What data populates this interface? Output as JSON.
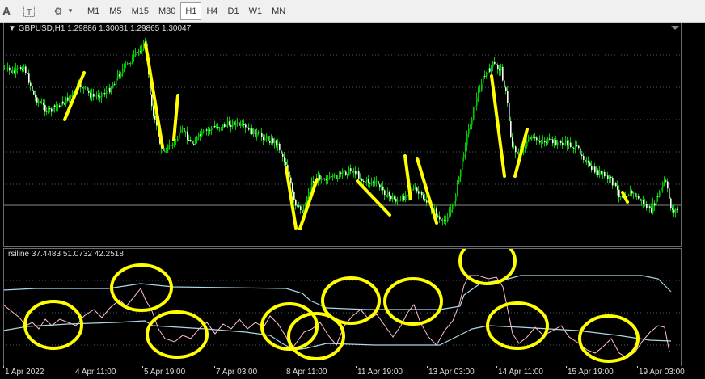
{
  "toolbar": {
    "text_tool": "A",
    "label_tool": "T",
    "shapes_tool": "⚙",
    "shapes_arrow": "▾",
    "timeframes": [
      {
        "label": "M1",
        "active": false
      },
      {
        "label": "M5",
        "active": false
      },
      {
        "label": "M15",
        "active": false
      },
      {
        "label": "M30",
        "active": false
      },
      {
        "label": "H1",
        "active": true
      },
      {
        "label": "H4",
        "active": false
      },
      {
        "label": "D1",
        "active": false
      },
      {
        "label": "W1",
        "active": false
      },
      {
        "label": "MN",
        "active": false
      }
    ]
  },
  "chart": {
    "symbol_info": "▼ GBPUSD,H1  1.29886 1.30081 1.29865 1.30047",
    "indicator_info": "rsiline 37.4483 51.0732 42.2518",
    "x_labels": [
      "1 Apr 2022",
      "4 Apr 11:00",
      "5 Apr 19:00",
      "7 Apr 03:00",
      "8 Apr 11:00",
      "11 Apr 19:00",
      "13 Apr 03:00",
      "14 Apr 11:00",
      "15 Apr 19:00",
      "19 Apr 03:00"
    ],
    "colors": {
      "background": "#000000",
      "candle_bull": "#00c800",
      "candle_bear": "#ffffff",
      "grid": "#4a5a6a",
      "annotation": "#ffff00",
      "rsi_line": "#ffc0cb",
      "band_line": "#add8e6"
    }
  }
}
